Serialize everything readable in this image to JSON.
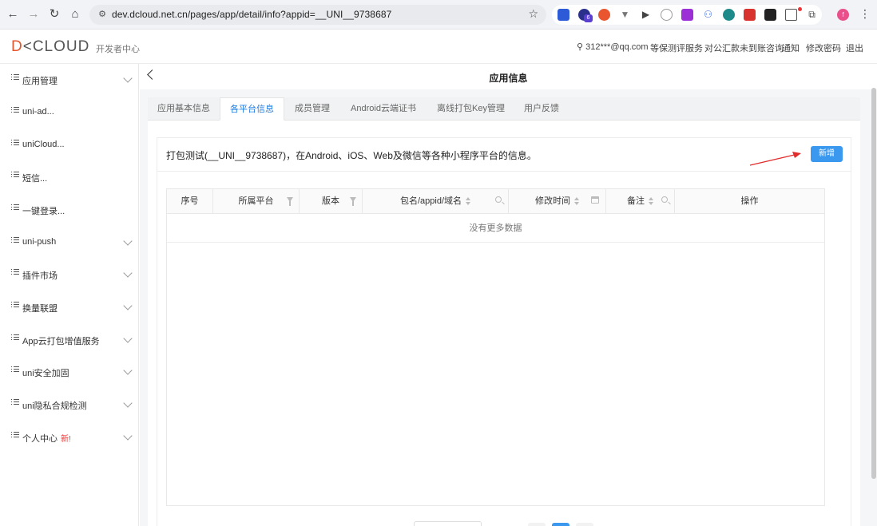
{
  "browser": {
    "url": "dev.dcloud.net.cn/pages/app/detail/info?appid=__UNI__9738687",
    "extension_badge": "6",
    "profile_initial": "f"
  },
  "header": {
    "logo_text_accent": "D",
    "logo_text_rest": "<CLOUD",
    "subtitle": "开发者中心",
    "links": {
      "account": "312***@qq.com",
      "service": "等保测评服务",
      "payment": "对公汇款未到账咨询",
      "notify": "通知",
      "password": "修改密码",
      "logout": "退出"
    }
  },
  "sidebar": {
    "items": [
      {
        "label": "应用管理",
        "expandable": true
      },
      {
        "label": "uni-ad...",
        "expandable": false
      },
      {
        "label": "uniCloud...",
        "expandable": false
      },
      {
        "label": "短信...",
        "expandable": false
      },
      {
        "label": "一键登录...",
        "expandable": false
      },
      {
        "label": "uni-push",
        "expandable": true
      },
      {
        "label": "插件市场",
        "expandable": true
      },
      {
        "label": "换量联盟",
        "expandable": true
      },
      {
        "label": "App云打包增值服务",
        "expandable": true
      },
      {
        "label": "uni安全加固",
        "expandable": true
      },
      {
        "label": "uni隐私合规检测",
        "expandable": true
      },
      {
        "label": "个人中心",
        "expandable": true,
        "badge": "新!"
      }
    ]
  },
  "page": {
    "title": "应用信息",
    "tabs": [
      {
        "label": "应用基本信息",
        "active": false
      },
      {
        "label": "各平台信息",
        "active": true
      },
      {
        "label": "成员管理",
        "active": false
      },
      {
        "label": "Android云端证书",
        "active": false
      },
      {
        "label": "离线打包Key管理",
        "active": false
      },
      {
        "label": "用户反馈",
        "active": false
      }
    ],
    "card_title": "打包测试(__UNI__9738687)，在Android、iOS、Web及微信等各种小程序平台的信息。",
    "add_button": "新增",
    "table": {
      "columns": [
        "序号",
        "所属平台",
        "版本",
        "包名/appid/域名",
        "修改时间",
        "备注",
        "操作"
      ],
      "empty_text": "没有更多数据"
    }
  },
  "colors": {
    "accent": "#1f7de0",
    "button": "#3a98ef",
    "arrow": "#e22b2b",
    "badge_new": "#e33333"
  }
}
